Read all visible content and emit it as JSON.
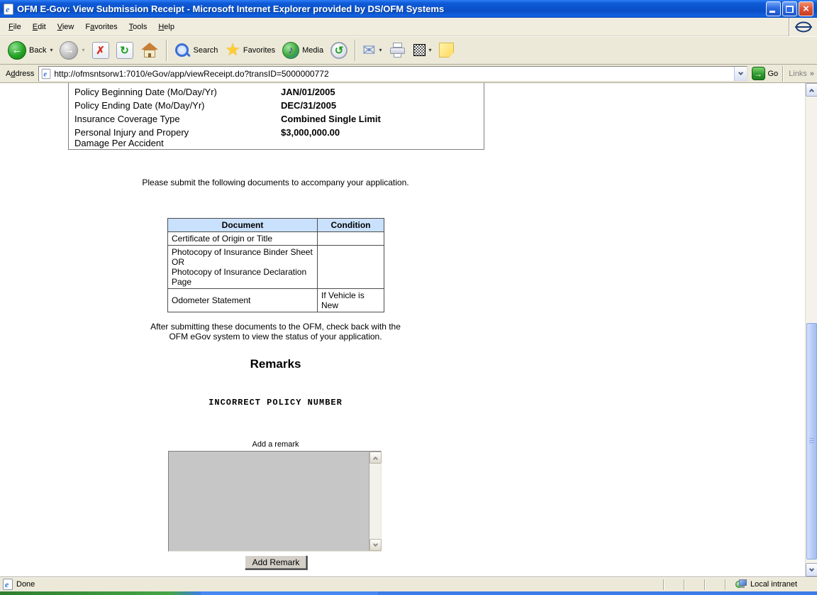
{
  "window": {
    "title": "OFM E-Gov: View Submission Receipt - Microsoft Internet Explorer provided by DS/OFM Systems"
  },
  "menu": {
    "items": [
      {
        "label": "File",
        "accel": 0
      },
      {
        "label": "Edit",
        "accel": 0
      },
      {
        "label": "View",
        "accel": 0
      },
      {
        "label": "Favorites",
        "accel": 1
      },
      {
        "label": "Tools",
        "accel": 0
      },
      {
        "label": "Help",
        "accel": 0
      }
    ]
  },
  "toolbar": {
    "back": "Back",
    "search": "Search",
    "favorites": "Favorites",
    "media": "Media"
  },
  "address": {
    "label": {
      "label": "Address",
      "accel": 1
    },
    "url": "http://ofmsntsorw1:7010/eGov/app/viewReceipt.do?transID=5000000772",
    "go": "Go",
    "links": "Links",
    "chevron": "»"
  },
  "page": {
    "policy_table": {
      "rows": [
        {
          "label": "Policy Beginning Date (Mo/Day/Yr)",
          "value": "JAN/01/2005"
        },
        {
          "label": "Policy Ending Date (Mo/Day/Yr)",
          "value": "DEC/31/2005"
        },
        {
          "label": "Insurance Coverage Type",
          "value": "Combined Single Limit"
        },
        {
          "label": "Personal Injury and Propery\nDamage Per Accident",
          "value": "$3,000,000.00"
        }
      ]
    },
    "submit_note": "Please submit the following documents to accompany your application.",
    "documents_table": {
      "headers": [
        "Document",
        "Condition"
      ],
      "header_bg": "#C9E1FC",
      "rows": [
        {
          "document": "Certificate of Origin or Title",
          "condition": ""
        },
        {
          "document": "Photocopy of Insurance Binder Sheet\nOR\nPhotocopy of Insurance Declaration Page",
          "condition": ""
        },
        {
          "document": "Odometer Statement",
          "condition": "If Vehicle is New"
        }
      ]
    },
    "after_note": "After submitting these documents to the OFM, check back with the\nOFM eGov system to view the status of your application.",
    "remarks_heading": "Remarks",
    "existing_remark": "INCORRECT POLICY NUMBER",
    "add_remark_label": "Add a remark",
    "remark_textarea_value": "",
    "add_remark_button": "Add Remark"
  },
  "status_bar": {
    "status": "Done",
    "zone": "Local intranet"
  },
  "colors": {
    "titlebar_blue": "#0A4FC6",
    "chrome_bg": "#ECE9D8",
    "table_header_bg": "#C9E1FC",
    "textarea_bg": "#C6C6C6",
    "scrollbar_thumb": "#B4C9F6"
  }
}
